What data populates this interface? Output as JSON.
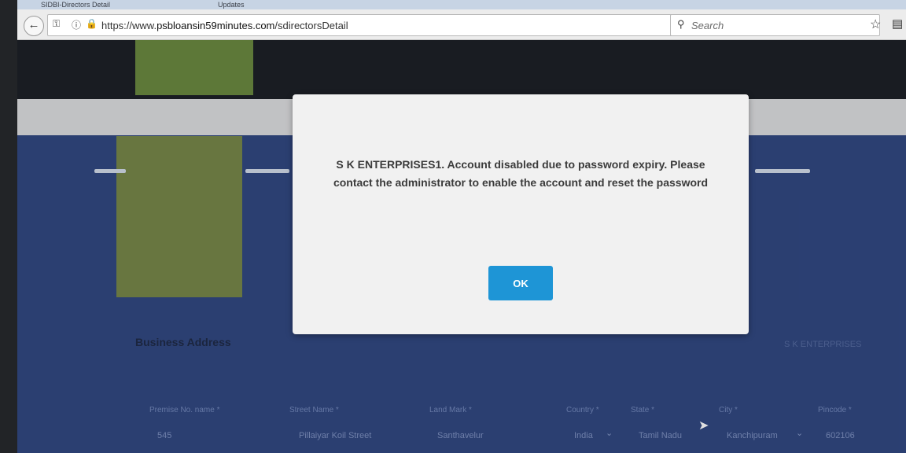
{
  "browser": {
    "tabs": [
      "SIDBI-Directors Detail",
      "Updates"
    ],
    "url_protocol": "https://www.",
    "url_host": "psbloansin59minutes.com",
    "url_path": "/sdirectorsDetail",
    "search_placeholder": "Search"
  },
  "page": {
    "section_title": "Business Address",
    "company_tag": "S K ENTERPRISES",
    "fields": [
      {
        "label": "Premise No. name *",
        "value": "545"
      },
      {
        "label": "Street Name *",
        "value": "Pillaiyar Koil Street"
      },
      {
        "label": "Land Mark *",
        "value": "Santhavelur"
      },
      {
        "label": "Country *",
        "value": "India"
      },
      {
        "label": "State *",
        "value": "Tamil Nadu"
      },
      {
        "label": "City *",
        "value": "Kanchipuram"
      },
      {
        "label": "Pincode *",
        "value": "602106"
      }
    ]
  },
  "modal": {
    "message": "S K ENTERPRISES1. Account disabled due to password expiry. Please contact the administrator to enable the account and reset the password",
    "ok_label": "OK"
  },
  "icons": {
    "back": "arrow-left-icon",
    "info": "info-icon",
    "lock": "lock-icon",
    "reload": "reload-icon",
    "search": "search-icon",
    "bookmark": "star-icon",
    "menu": "reading-list-icon"
  },
  "colors": {
    "ok_button": "#1e95d6",
    "page_background": "#324a84",
    "modal_background": "#f1f1f1"
  }
}
